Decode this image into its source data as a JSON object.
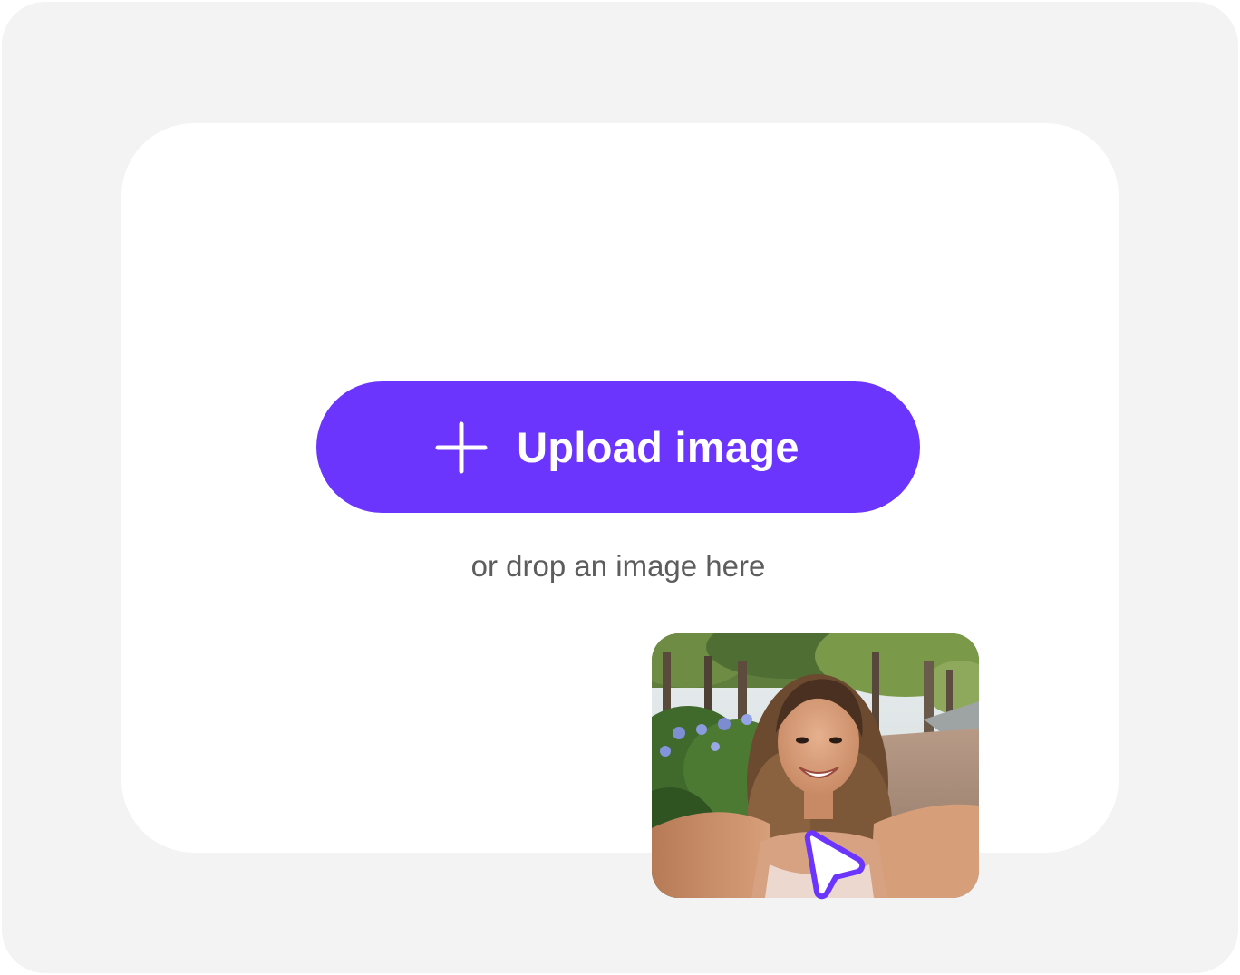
{
  "theme": {
    "accent": "#6b35fd",
    "background": "#f3f3f3",
    "panel": "#ffffff",
    "hint_text": "#5d5d5d"
  },
  "upload": {
    "icon": "plus-icon",
    "label": "Upload image"
  },
  "dropzone": {
    "hint": "or drop an image here"
  },
  "preview": {
    "image": "selfie-photo-woman-park",
    "cursor_icon": "pointer-cursor-icon"
  }
}
